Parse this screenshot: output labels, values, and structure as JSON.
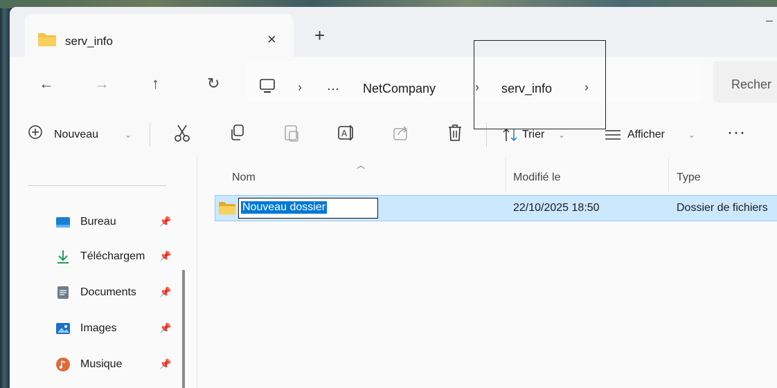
{
  "tab": {
    "title": "serv_info",
    "close_glyph": "×",
    "new_tab_glyph": "+"
  },
  "nav_buttons": {
    "back": "←",
    "forward": "→",
    "up": "↑",
    "refresh": "↻"
  },
  "address": {
    "sep1": "›",
    "ellipsis": "···",
    "crumb1": "NetCompany",
    "sep2": "›",
    "crumb2": "serv_info",
    "sep3": "›"
  },
  "search": {
    "placeholder": "Recher"
  },
  "toolbar": {
    "new_label": "Nouveau",
    "sort_label": "Trier",
    "view_label": "Afficher",
    "more_glyph": "···",
    "chevron": "⌄"
  },
  "sidebar": {
    "items": [
      {
        "label": "Bureau",
        "icon": "desktop-icon",
        "color": "#1a7fd4"
      },
      {
        "label": "Téléchargem",
        "icon": "download-icon",
        "color": "#1e9e5a"
      },
      {
        "label": "Documents",
        "icon": "document-icon",
        "color": "#6e7b8b"
      },
      {
        "label": "Images",
        "icon": "images-icon",
        "color": "#1f6fc8"
      },
      {
        "label": "Musique",
        "icon": "music-icon",
        "color": "#e06a3a"
      }
    ]
  },
  "columns": {
    "name": "Nom",
    "modified": "Modifié le",
    "type": "Type"
  },
  "rows": [
    {
      "name": "Nouveau dossier",
      "modified": "22/10/2025 18:50",
      "type": "Dossier de fichiers"
    }
  ],
  "colors": {
    "selection": "#cce8ff",
    "accent": "#0078d7",
    "folder": "#f4c142"
  }
}
